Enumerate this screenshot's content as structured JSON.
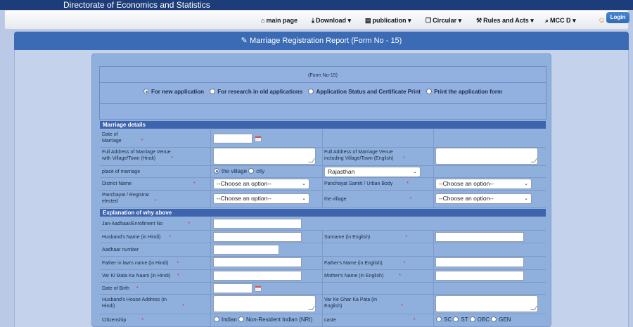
{
  "site": {
    "title": "Directorate of Economics and Statistics"
  },
  "nav": {
    "items": [
      {
        "label": "main page",
        "icon": "home-icon"
      },
      {
        "label": "Download",
        "icon": "download-icon",
        "caret": "▾"
      },
      {
        "label": "publication",
        "icon": "document-icon",
        "caret": "▾"
      },
      {
        "label": "Circular",
        "icon": "copy-icon",
        "caret": "▾"
      },
      {
        "label": "Rules and Acts",
        "icon": "gavel-icon",
        "caret": "▾"
      },
      {
        "label": "MCC D",
        "icon": "search-icon",
        "caret": "▾"
      }
    ],
    "login_label": "Login"
  },
  "panel": {
    "title": "Marriage Registration Report (Form No - 15)",
    "title_icon": "edit-icon"
  },
  "form": {
    "form_no": "(Form No-15)",
    "modes": [
      {
        "label": "For new application",
        "selected": true
      },
      {
        "label": "For research in old applications",
        "selected": false
      },
      {
        "label": "Application Status and Certificate Print",
        "selected": false
      },
      {
        "label": "Print the application form",
        "selected": false
      }
    ],
    "sections": {
      "marriage_details": "Marriage details",
      "explanation": "Explanation of why above"
    },
    "labels": {
      "date_of_marriage_1": "Date of",
      "date_of_marriage_2": "Marriage",
      "venue_hindi_1": "Full Address of Marriage Venue",
      "venue_hindi_2": "with Village/Town (Hindi)",
      "venue_english_1": "Full Address of Marriage Venue",
      "venue_english_2": "including Village/Town (English)",
      "place_of_marriage": "place of marriage",
      "district_name": "District Name",
      "panchayat_samiti": "Panchayat Samiti / Urban Body",
      "panchayat_registrar_1": "Panchayat / Registrar",
      "panchayat_registrar_2": "elected",
      "the_village": "the village",
      "jan_aadhaar": "Jan-Aadhaar/Enrollment No",
      "husband_name_hindi": "Husband's Name (in Hindi)",
      "surname_english": "Surname (in English)",
      "aadhaar_number": "Aadhaar number",
      "father_in_law_hindi": "Father in law's name (in Hindi)",
      "father_name_english": "Father's Name (in English)",
      "var_ki_mata": "Var Ki Mata Ka Naam (in Hindi)",
      "mother_name_english": "Mother's Name (in English)",
      "date_of_birth": "Date of Birth",
      "husband_address_1": "Husband's House Address (in",
      "husband_address_2": "Hindi)",
      "var_ke_ghar_1": "Var Ke Ghar Ka Pata (in",
      "var_ke_ghar_2": "English)",
      "citizenship": "Citizenship",
      "caste": "caste"
    },
    "required_mark": "*",
    "place_options": [
      {
        "label": "the village",
        "selected": true
      },
      {
        "label": "city",
        "selected": false
      }
    ],
    "state_select": "Rajasthan",
    "choose_option": "--Choose an option--",
    "citizenship_options": [
      "Indian",
      "Non-Resident Indian (NRI)"
    ],
    "caste_options": [
      "SC",
      "ST",
      "OBC",
      "GEN"
    ]
  },
  "colors": {
    "header_blue": "#3b6bb4",
    "section_blue": "#3d64ad",
    "required_red": "#d8242c"
  }
}
